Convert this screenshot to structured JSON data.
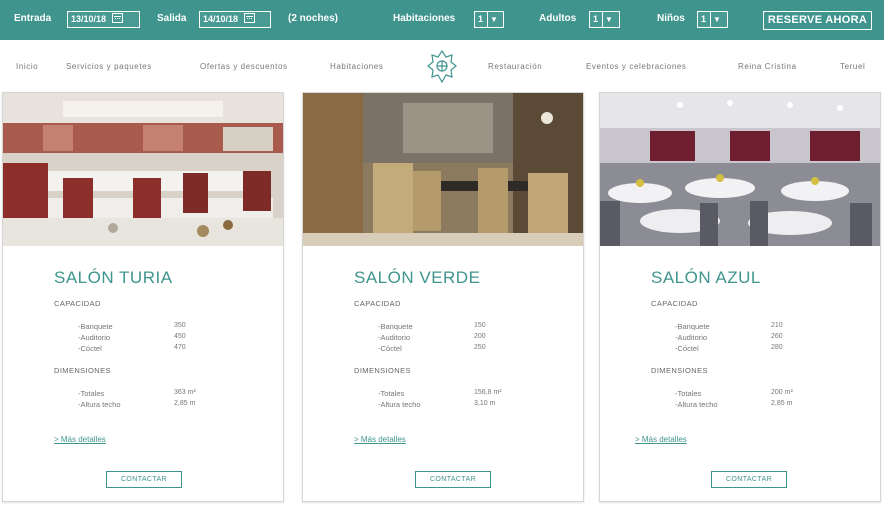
{
  "booking": {
    "entrada_label": "Entrada",
    "entrada_value": "13/10/18",
    "salida_label": "Salida",
    "salida_value": "14/10/18",
    "nights": "(2 noches)",
    "habitaciones_label": "Habitaciones",
    "habitaciones_value": "1",
    "adultos_label": "Adultos",
    "adultos_value": "1",
    "ninos_label": "Niños",
    "ninos_value": "1",
    "reserve_label": "RESERVE AHORA"
  },
  "nav": {
    "items": [
      "Inicio",
      "Servicios y paquetes",
      "Ofertas y descuentos",
      "Habitaciones",
      "Restauración",
      "Eventos y celebraciones",
      "Reina Cristina",
      "Teruel"
    ]
  },
  "cards": [
    {
      "title": "SALÓN TURIA",
      "capacity_label": "CAPACIDAD",
      "capacity": [
        {
          "label": "-Banquete",
          "value": "350"
        },
        {
          "label": "-Auditorio",
          "value": "450"
        },
        {
          "label": "-Cóctel",
          "value": "470"
        }
      ],
      "dimensions_label": "DIMENSIONES",
      "dimensions": [
        {
          "label": "-Totales",
          "value": "363 m²"
        },
        {
          "label": "-Altura techo",
          "value": "2,85 m"
        }
      ],
      "details_link": "> Más detalles",
      "contact_label": "CONTACTAR"
    },
    {
      "title": "SALÓN VERDE",
      "capacity_label": "CAPACIDAD",
      "capacity": [
        {
          "label": "-Banquete",
          "value": "150"
        },
        {
          "label": "-Auditorio",
          "value": "200"
        },
        {
          "label": "-Cóctel",
          "value": "250"
        }
      ],
      "dimensions_label": "DIMENSIONES",
      "dimensions": [
        {
          "label": "-Totales",
          "value": "156,8 m²"
        },
        {
          "label": "-Altura techo",
          "value": "3,10 m"
        }
      ],
      "details_link": "> Más detalles",
      "contact_label": "CONTACTAR"
    },
    {
      "title": "SALÓN AZUL",
      "capacity_label": "CAPACIDAD",
      "capacity": [
        {
          "label": "-Banquete",
          "value": "210"
        },
        {
          "label": "-Auditorio",
          "value": "260"
        },
        {
          "label": "-Cóctel",
          "value": "280"
        }
      ],
      "dimensions_label": "DIMENSIONES",
      "dimensions": [
        {
          "label": "-Totales",
          "value": "200 m²"
        },
        {
          "label": "-Altura techo",
          "value": "2,85 m"
        }
      ],
      "details_link": "> Más detalles",
      "contact_label": "CONTACTAR"
    }
  ],
  "colors": {
    "brand": "#3f958e",
    "card_border": "#d6d6d6",
    "text_muted": "#777777"
  }
}
